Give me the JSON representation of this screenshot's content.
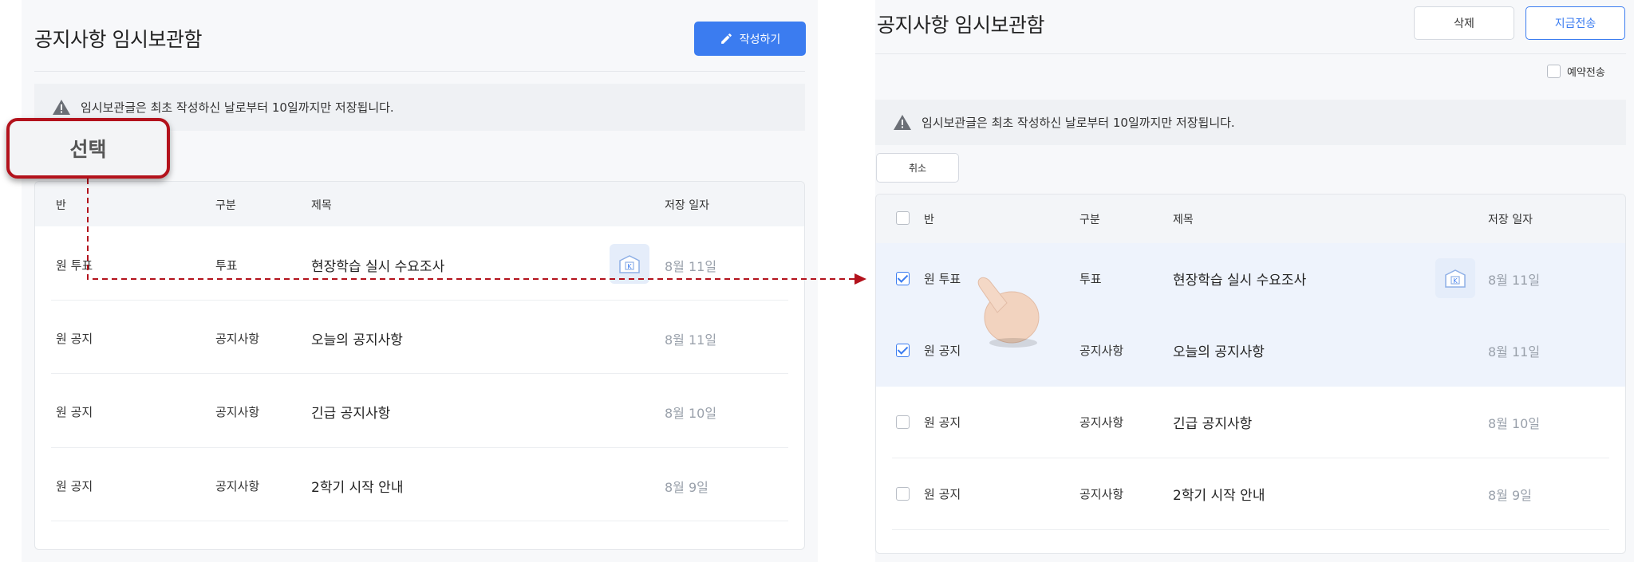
{
  "colors": {
    "primary": "#3b7cf0",
    "annotation": "#b3121c"
  },
  "left": {
    "title": "공지사항 임시보관함",
    "write_button": "작성하기",
    "notice": "임시보관글은 최초 작성하신 날로부터 10일까지만 저장됩니다.",
    "columns": [
      "반",
      "구분",
      "제목",
      "저장 일자"
    ],
    "rows": [
      {
        "class": "원 투표",
        "type": "투표",
        "title": "현장학습 실시 수요조사",
        "date": "8월 11일",
        "icon": "vote-box-icon"
      },
      {
        "class": "원 공지",
        "type": "공지사항",
        "title": "오늘의 공지사항",
        "date": "8월 11일"
      },
      {
        "class": "원 공지",
        "type": "공지사항",
        "title": "긴급 공지사항",
        "date": "8월 10일"
      },
      {
        "class": "원 공지",
        "type": "공지사항",
        "title": "2학기 시작 안내",
        "date": "8월 9일"
      }
    ]
  },
  "callout": {
    "label": "선택"
  },
  "right": {
    "title": "공지사항 임시보관함",
    "delete_button": "삭제",
    "send_now_button": "지금전송",
    "reserve_label": "예약전송",
    "reserve_checked": false,
    "notice": "임시보관글은 최초 작성하신 날로부터 10일까지만 저장됩니다.",
    "cancel_button": "취소",
    "columns": [
      "반",
      "구분",
      "제목",
      "저장 일자"
    ],
    "rows": [
      {
        "class": "원 투표",
        "type": "투표",
        "title": "현장학습 실시 수요조사",
        "date": "8월 11일",
        "checked": true,
        "icon": "vote-box-icon"
      },
      {
        "class": "원 공지",
        "type": "공지사항",
        "title": "오늘의 공지사항",
        "date": "8월 11일",
        "checked": true
      },
      {
        "class": "원 공지",
        "type": "공지사항",
        "title": "긴급 공지사항",
        "date": "8월 10일",
        "checked": false
      },
      {
        "class": "원 공지",
        "type": "공지사항",
        "title": "2학기 시작 안내",
        "date": "8월 9일",
        "checked": false
      }
    ]
  }
}
